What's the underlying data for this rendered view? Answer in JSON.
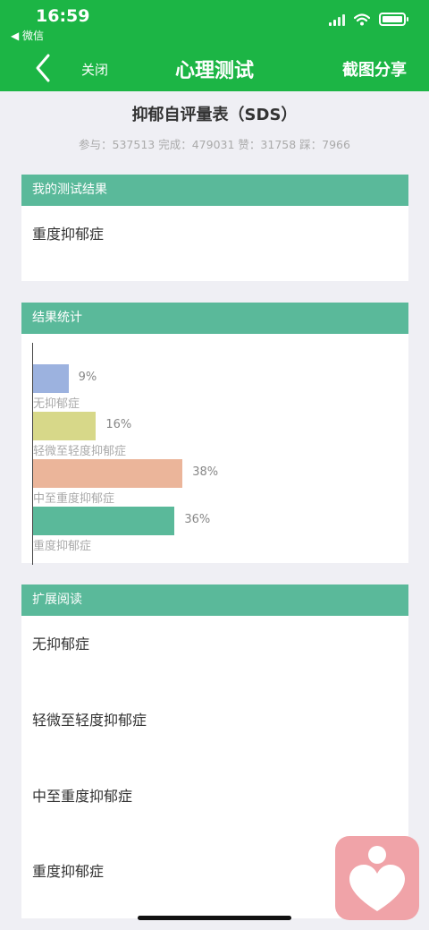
{
  "status_bar": {
    "time": "16:59",
    "back_app": "◀ 微信"
  },
  "nav": {
    "close_label": "关闭",
    "title": "心理测试",
    "share_label": "截图分享"
  },
  "test": {
    "title": "抑郁自评量表（SDS）",
    "stats": "参与：537513 完成：479031 赞：31758 踩：7966"
  },
  "my_result": {
    "header": "我的测试结果",
    "text": "重度抑郁症"
  },
  "statistics": {
    "header": "结果统计"
  },
  "chart_data": {
    "type": "bar",
    "orientation": "horizontal",
    "categories": [
      "无抑郁症",
      "轻微至轻度抑郁症",
      "中至重度抑郁症",
      "重度抑郁症"
    ],
    "values": [
      9,
      16,
      38,
      36
    ],
    "value_labels": [
      "9%",
      "16%",
      "38%",
      "36%"
    ],
    "colors": [
      "#9cb2df",
      "#d7d889",
      "#ebb59a",
      "#5ab99a"
    ],
    "xlim": [
      0,
      100
    ]
  },
  "reading": {
    "header": "扩展阅读",
    "items": [
      "无抑郁症",
      "轻微至轻度抑郁症",
      "中至重度抑郁症",
      "重度抑郁症"
    ]
  }
}
